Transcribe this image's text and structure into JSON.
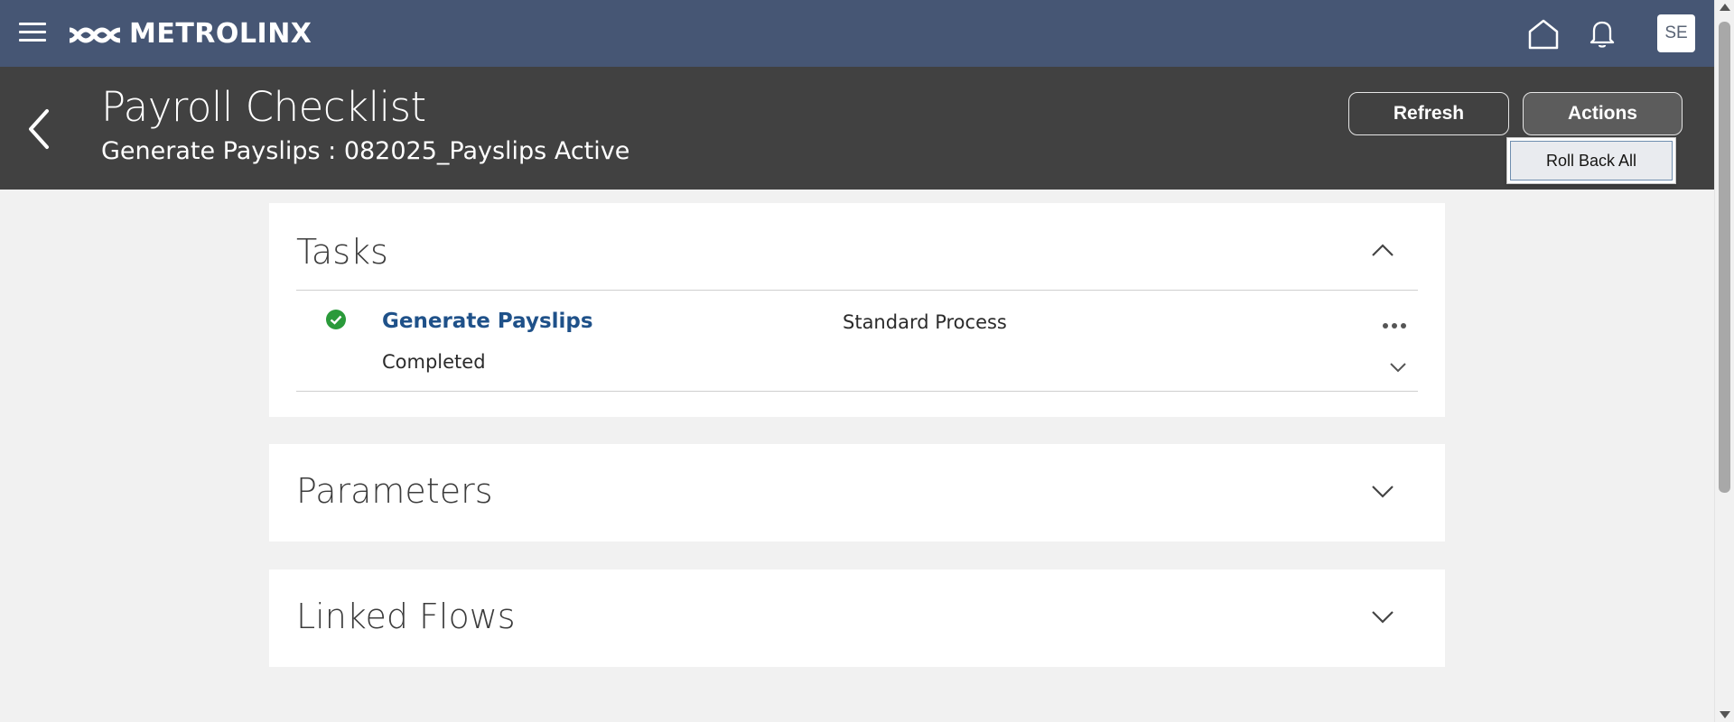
{
  "header": {
    "brand": "METROLINX",
    "avatar_initials": "SE",
    "brand_color": "#465674"
  },
  "page": {
    "title": "Payroll Checklist",
    "subtitle": "Generate Payslips : 082025_Payslips Active"
  },
  "toolbar": {
    "refresh_label": "Refresh",
    "actions_label": "Actions",
    "actions_menu": [
      "Roll Back All"
    ]
  },
  "tasks": {
    "title": "Tasks",
    "expanded": true,
    "rows": [
      {
        "name": "Generate Payslips",
        "type": "Standard Process",
        "status": "Completed",
        "status_color": "#2a9a3a"
      }
    ]
  },
  "parameters": {
    "title": "Parameters",
    "expanded": false
  },
  "linked_flows": {
    "title": "Linked Flows",
    "expanded": false
  },
  "icons": [
    "menu-icon",
    "home-icon",
    "bell-icon",
    "back-arrow-icon",
    "check-circle-icon",
    "more-icon",
    "chevron-up-icon",
    "chevron-down-icon"
  ]
}
